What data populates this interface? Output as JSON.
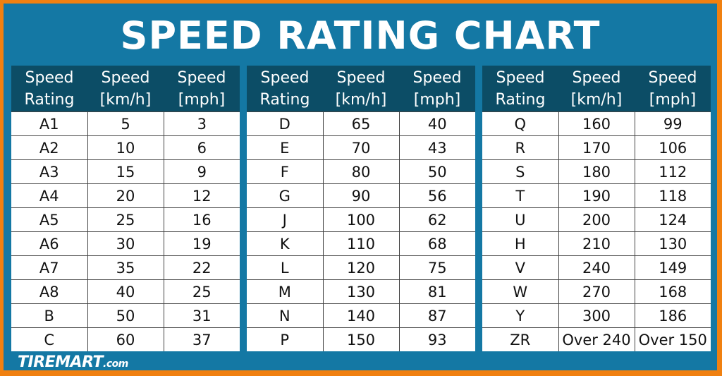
{
  "chart_data": {
    "type": "table",
    "title": "SPEED RATING CHART",
    "columns": [
      "Speed Rating",
      "Speed [km/h]",
      "Speed [mph]"
    ],
    "header_lines": [
      [
        "Speed",
        "Rating"
      ],
      [
        "Speed",
        "[km/h]"
      ],
      [
        "Speed",
        "[mph]"
      ]
    ],
    "tables": [
      {
        "rows": [
          [
            "A1",
            "5",
            "3"
          ],
          [
            "A2",
            "10",
            "6"
          ],
          [
            "A3",
            "15",
            "9"
          ],
          [
            "A4",
            "20",
            "12"
          ],
          [
            "A5",
            "25",
            "16"
          ],
          [
            "A6",
            "30",
            "19"
          ],
          [
            "A7",
            "35",
            "22"
          ],
          [
            "A8",
            "40",
            "25"
          ],
          [
            "B",
            "50",
            "31"
          ],
          [
            "C",
            "60",
            "37"
          ]
        ]
      },
      {
        "rows": [
          [
            "D",
            "65",
            "40"
          ],
          [
            "E",
            "70",
            "43"
          ],
          [
            "F",
            "80",
            "50"
          ],
          [
            "G",
            "90",
            "56"
          ],
          [
            "J",
            "100",
            "62"
          ],
          [
            "K",
            "110",
            "68"
          ],
          [
            "L",
            "120",
            "75"
          ],
          [
            "M",
            "130",
            "81"
          ],
          [
            "N",
            "140",
            "87"
          ],
          [
            "P",
            "150",
            "93"
          ]
        ]
      },
      {
        "rows": [
          [
            "Q",
            "160",
            "99"
          ],
          [
            "R",
            "170",
            "106"
          ],
          [
            "S",
            "180",
            "112"
          ],
          [
            "T",
            "190",
            "118"
          ],
          [
            "U",
            "200",
            "124"
          ],
          [
            "H",
            "210",
            "130"
          ],
          [
            "V",
            "240",
            "149"
          ],
          [
            "W",
            "270",
            "168"
          ],
          [
            "Y",
            "300",
            "186"
          ],
          [
            "ZR",
            "Over 240",
            "Over 150"
          ]
        ]
      }
    ]
  },
  "brand": {
    "name": "TIREMART",
    "suffix": ".com"
  },
  "colors": {
    "border": "#f08010",
    "background": "#1478a4",
    "header": "#0c4d66"
  }
}
